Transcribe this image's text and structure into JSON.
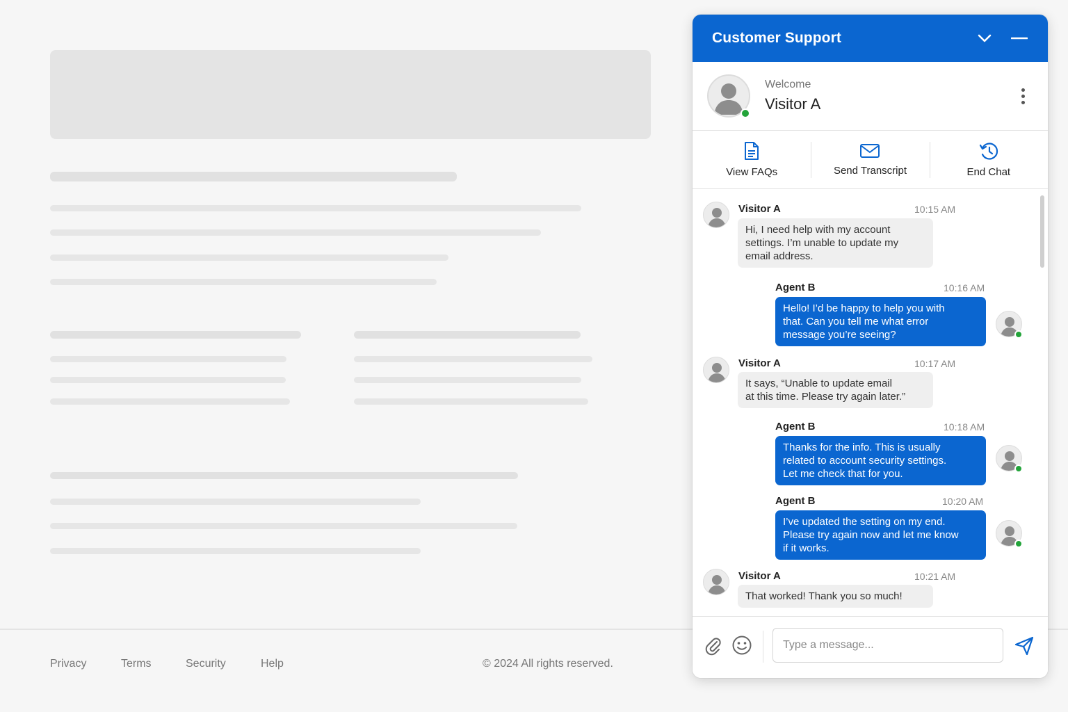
{
  "footer": {
    "links": [
      "Privacy",
      "Terms",
      "Security",
      "Help"
    ],
    "copyright": "© 2024 All rights reserved."
  },
  "chat": {
    "title": "Customer Support",
    "header_icons": [
      "chevron-down-icon",
      "minimize-icon"
    ],
    "welcome": {
      "label": "Welcome",
      "name": "Visitor A",
      "status": "online"
    },
    "actions": [
      {
        "label": "View FAQs",
        "icon": "document-icon"
      },
      {
        "label": "Send Transcript",
        "icon": "envelope-icon"
      },
      {
        "label": "End Chat",
        "icon": "history-icon"
      }
    ],
    "messages": [
      {
        "sender": "Visitor A",
        "time": "10:15 AM",
        "text": "Hi, I need help with my account\nsettings. I’m unable to update my\nemail address."
      },
      {
        "sender": "Agent B",
        "time": "10:16 AM",
        "text": "Hello! I’d be happy to help you with\nthat. Can you tell me what error\nmessage you’re seeing?"
      },
      {
        "sender": "Visitor A",
        "time": "10:17 AM",
        "text": "It says, “Unable to update email\nat this time. Please try again later.”"
      },
      {
        "sender": "Agent B",
        "time": "10:18 AM",
        "text": "Thanks for the info. This is usually\nrelated to account security settings.\nLet me check that for you."
      },
      {
        "sender": "Agent B",
        "time": "10:20 AM",
        "text": "I’ve updated the setting on my end.\nPlease try again now and let me know\nif it works."
      },
      {
        "sender": "Visitor A",
        "time": "10:21 AM",
        "text": "That worked! Thank you so much!"
      }
    ],
    "composer": {
      "placeholder": "Type a message...",
      "icons": [
        "paperclip-icon",
        "smiley-icon",
        "send-icon"
      ]
    },
    "colors": {
      "accent": "#0b66d0",
      "online": "#23a43a",
      "visitor_bubble": "#efefef"
    }
  }
}
